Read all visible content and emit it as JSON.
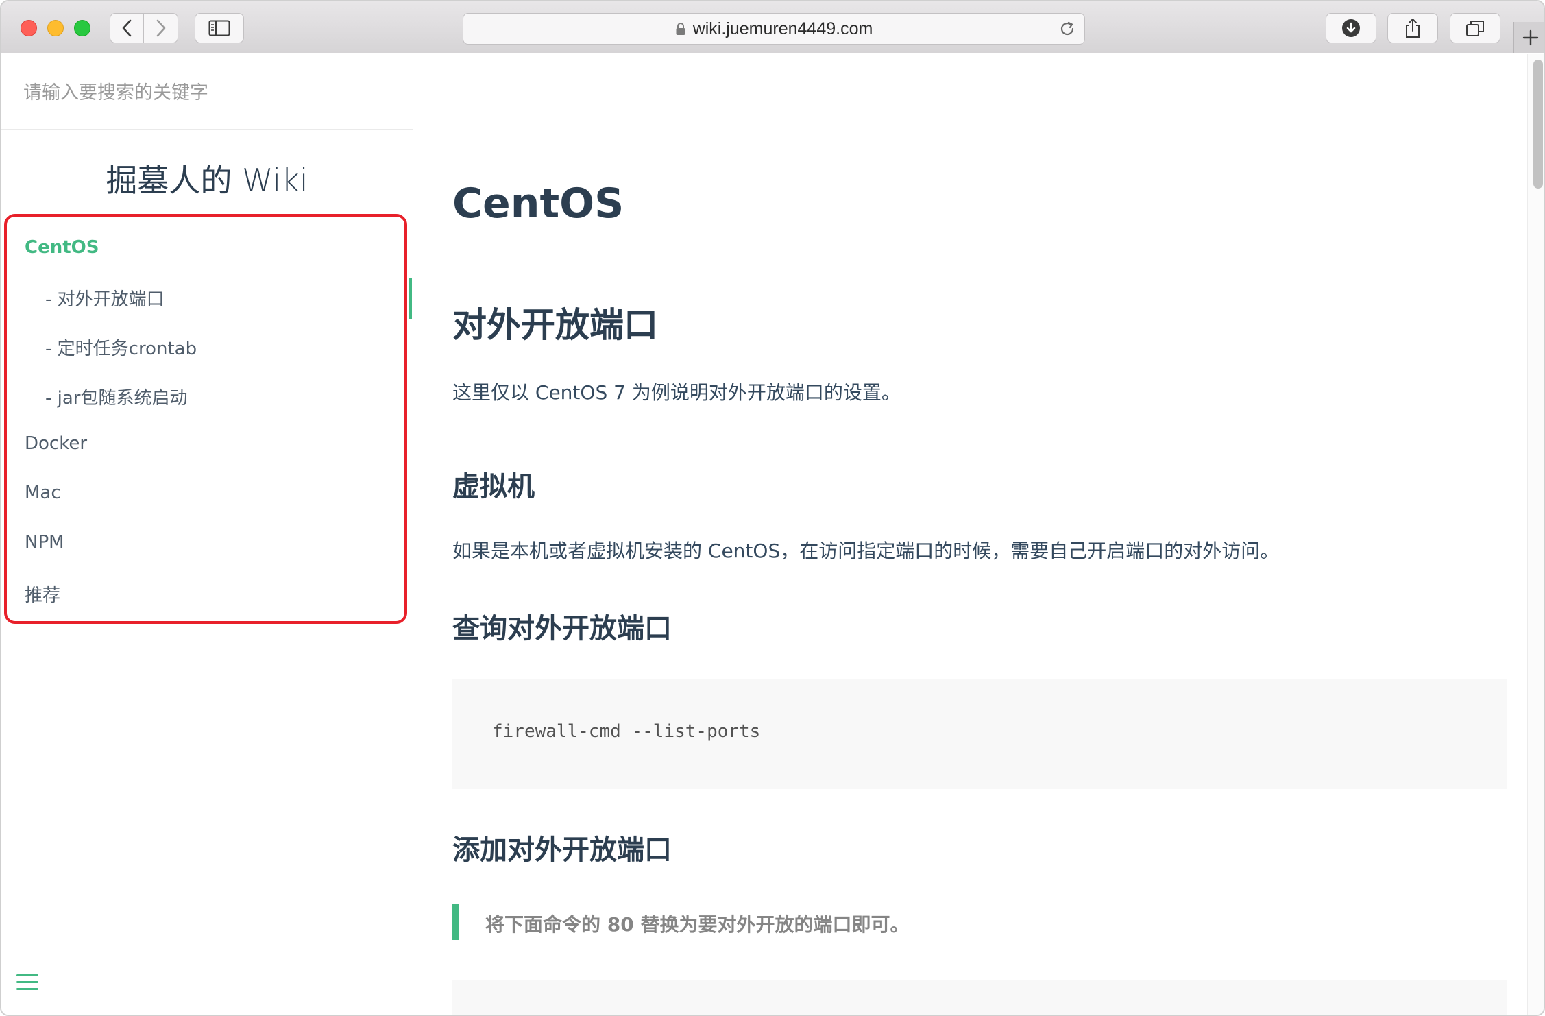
{
  "browser": {
    "url": "wiki.juemuren4449.com",
    "icons": {
      "back": "chevron-left-icon",
      "forward": "chevron-right-icon",
      "sidebar": "sidebar-toggle-icon",
      "lock": "lock-icon",
      "reload": "reload-icon",
      "download": "download-icon",
      "share": "share-icon",
      "tabs": "tab-overview-icon",
      "new_tab": "plus-icon"
    }
  },
  "sidebar": {
    "search_placeholder": "请输入要搜索的关键字",
    "site_title": "掘墓人的 Wiki",
    "nav": [
      {
        "label": "CentOS",
        "active": true
      },
      {
        "label": "- 对外开放端口"
      },
      {
        "label": "- 定时任务crontab"
      },
      {
        "label": "- jar包随系统启动"
      },
      {
        "label": "Docker"
      },
      {
        "label": "Mac"
      },
      {
        "label": "NPM"
      },
      {
        "label": "推荐"
      }
    ],
    "highlight_color": "#e8202a",
    "accent_color": "#42b983"
  },
  "content": {
    "title": "CentOS",
    "section_title": "对外开放端口",
    "intro": "这里仅以 CentOS 7 为例说明对外开放端口的设置。",
    "vm_title": "虚拟机",
    "vm_text": "如果是本机或者虚拟机安装的 CentOS，在访问指定端口的时候，需要自己开启端口的对外访问。",
    "query_title": "查询对外开放端口",
    "query_code": "firewall-cmd --list-ports",
    "add_title": "添加对外开放端口",
    "add_note": "将下面命令的 80 替换为要对外开放的端口即可。"
  }
}
